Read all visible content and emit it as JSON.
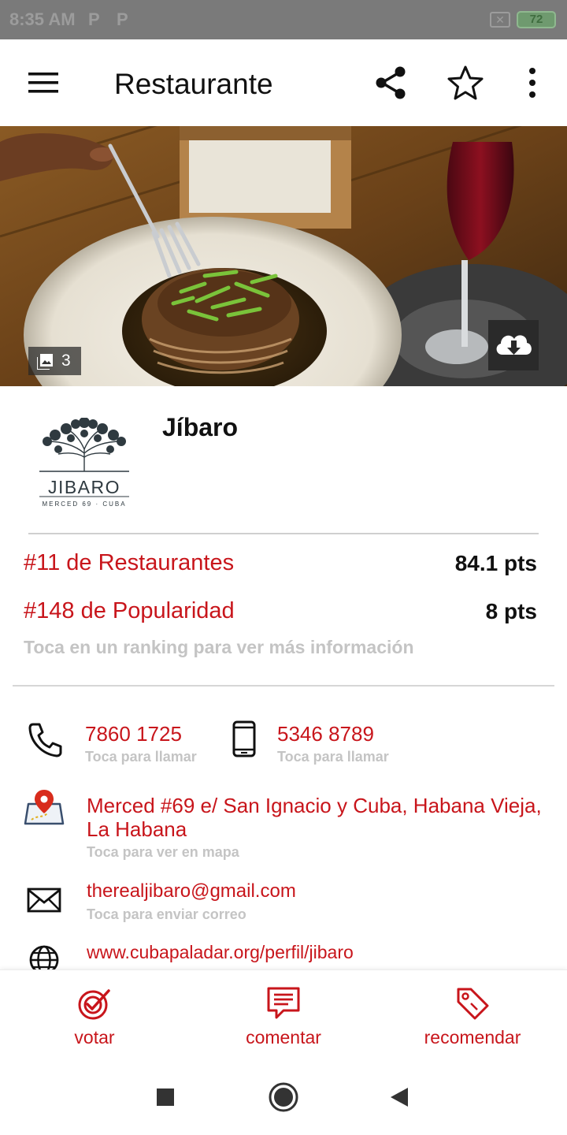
{
  "status_bar": {
    "time": "8:35 AM",
    "notification_icons": [
      "P",
      "P"
    ],
    "battery_level": "72"
  },
  "app_bar": {
    "title": "Restaurante",
    "icons": [
      "menu-icon",
      "share-icon",
      "star-outline-icon",
      "more-vert-icon"
    ]
  },
  "hero": {
    "photo_count": "3",
    "icons": [
      "gallery-icon",
      "cloud-download-icon"
    ]
  },
  "restaurant": {
    "name": "Jíbaro",
    "logo": {
      "brand": "JIBARO",
      "tagline": "MERCED 69 · CUBA"
    }
  },
  "rankings": [
    {
      "label": "#11 de Restaurantes",
      "points": "84.1 pts"
    },
    {
      "label": "#148 de Popularidad",
      "points": "8 pts"
    }
  ],
  "ranking_hint": "Toca en un ranking para ver más información",
  "contacts": {
    "phone": {
      "value": "7860 1725",
      "hint": "Toca para llamar",
      "icon": "phone-icon"
    },
    "mobile": {
      "value": "5346 8789",
      "hint": "Toca para llamar",
      "icon": "mobile-phone-icon"
    },
    "address": {
      "line1": "Merced #69 e/ San Ignacio y Cuba, Habana Vieja,",
      "line2": "La Habana",
      "hint": "Toca para ver en mapa",
      "icon": "map-pin-icon"
    },
    "email": {
      "value": "therealjibaro@gmail.com",
      "hint": "Toca para enviar correo",
      "icon": "envelope-icon"
    },
    "website": {
      "value": "www.cubapaladar.org/perfil/jibaro",
      "icon": "globe-icon"
    }
  },
  "actions": [
    {
      "label": "votar",
      "icon": "vote-target-icon"
    },
    {
      "label": "comentar",
      "icon": "comment-icon"
    },
    {
      "label": "recomendar",
      "icon": "tag-icon"
    }
  ],
  "colors": {
    "accent": "#c8151b",
    "hint_gray": "#c4c4c4",
    "text": "#111111"
  }
}
